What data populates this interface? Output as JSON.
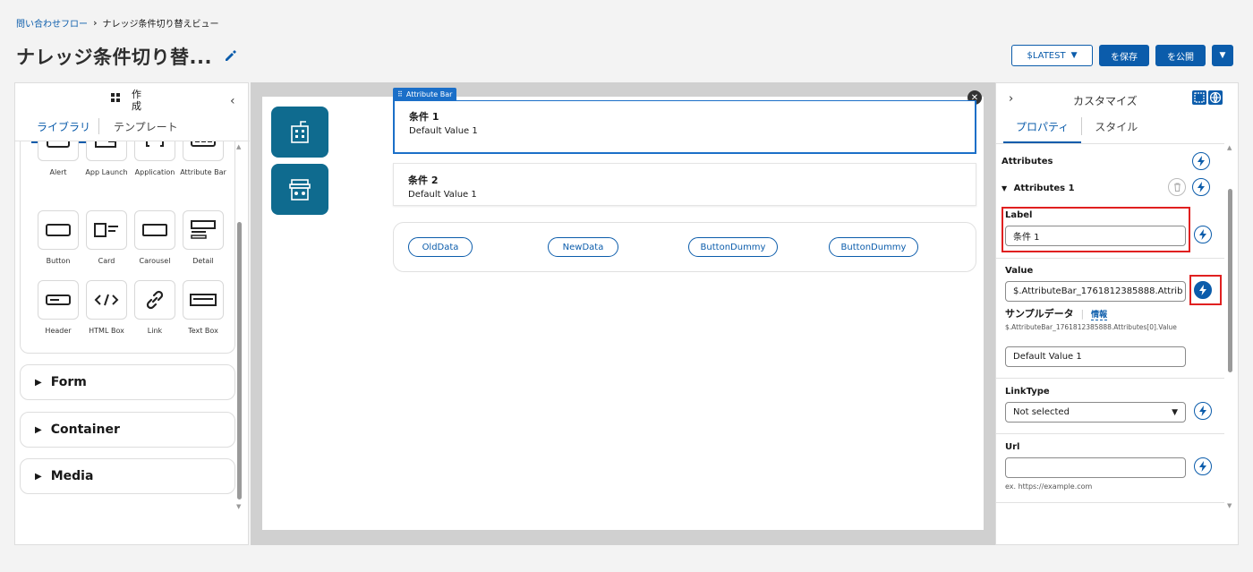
{
  "breadcrumb": {
    "parent": "問い合わせフロー",
    "current": "ナレッジ条件切り替えビュー"
  },
  "page_title": "ナレッジ条件切り替...",
  "actions": {
    "version": "$LATEST",
    "save": "を保存",
    "publish": "を公開"
  },
  "left_panel": {
    "title": "作成",
    "tabs": [
      "ライブラリ",
      "テンプレート"
    ],
    "components": [
      {
        "label": "Alert",
        "icon": "alert-icon"
      },
      {
        "label": "App Launch",
        "icon": "app-launch-icon"
      },
      {
        "label": "Application",
        "icon": "application-icon"
      },
      {
        "label": "Attribute Bar",
        "icon": "attribute-bar-icon"
      },
      {
        "label": "Button",
        "icon": "button-icon"
      },
      {
        "label": "Card",
        "icon": "card-icon"
      },
      {
        "label": "Carousel",
        "icon": "carousel-icon"
      },
      {
        "label": "Detail",
        "icon": "detail-icon"
      },
      {
        "label": "Header",
        "icon": "header-icon"
      },
      {
        "label": "HTML Box",
        "icon": "html-box-icon"
      },
      {
        "label": "Link",
        "icon": "link-icon"
      },
      {
        "label": "Text Box",
        "icon": "text-box-icon"
      }
    ],
    "sections": [
      "Form",
      "Container",
      "Media"
    ]
  },
  "canvas": {
    "attribute_bar_tag": "Attribute Bar",
    "conditions": [
      {
        "title": "条件 1",
        "value": "Default Value 1"
      },
      {
        "title": "条件 2",
        "value": "Default Value 1"
      }
    ],
    "buttons": [
      "OldData",
      "NewData",
      "ButtonDummy",
      "ButtonDummy"
    ]
  },
  "right_panel": {
    "title": "カスタマイズ",
    "tabs": [
      "プロパティ",
      "スタイル"
    ],
    "attributes_heading": "Attributes",
    "attributes_group": "Attributes 1",
    "label_heading": "Label",
    "label_value": "条件 1",
    "value_heading": "Value",
    "value_value": "$.AttributeBar_1761812385888.Attrib",
    "sample_data_heading": "サンプルデータ",
    "sample_data_info": "情報",
    "sample_data_path": "$.AttributeBar_1761812385888.Attributes[0].Value",
    "sample_data_value": "Default Value 1",
    "linktype_heading": "LinkType",
    "linktype_value": "Not selected",
    "url_heading": "Url",
    "url_value": "",
    "url_hint": "ex. https://example.com"
  },
  "colors": {
    "accent": "#0b5cab",
    "highlight": "#e02020",
    "tile": "#0f6b8f"
  }
}
